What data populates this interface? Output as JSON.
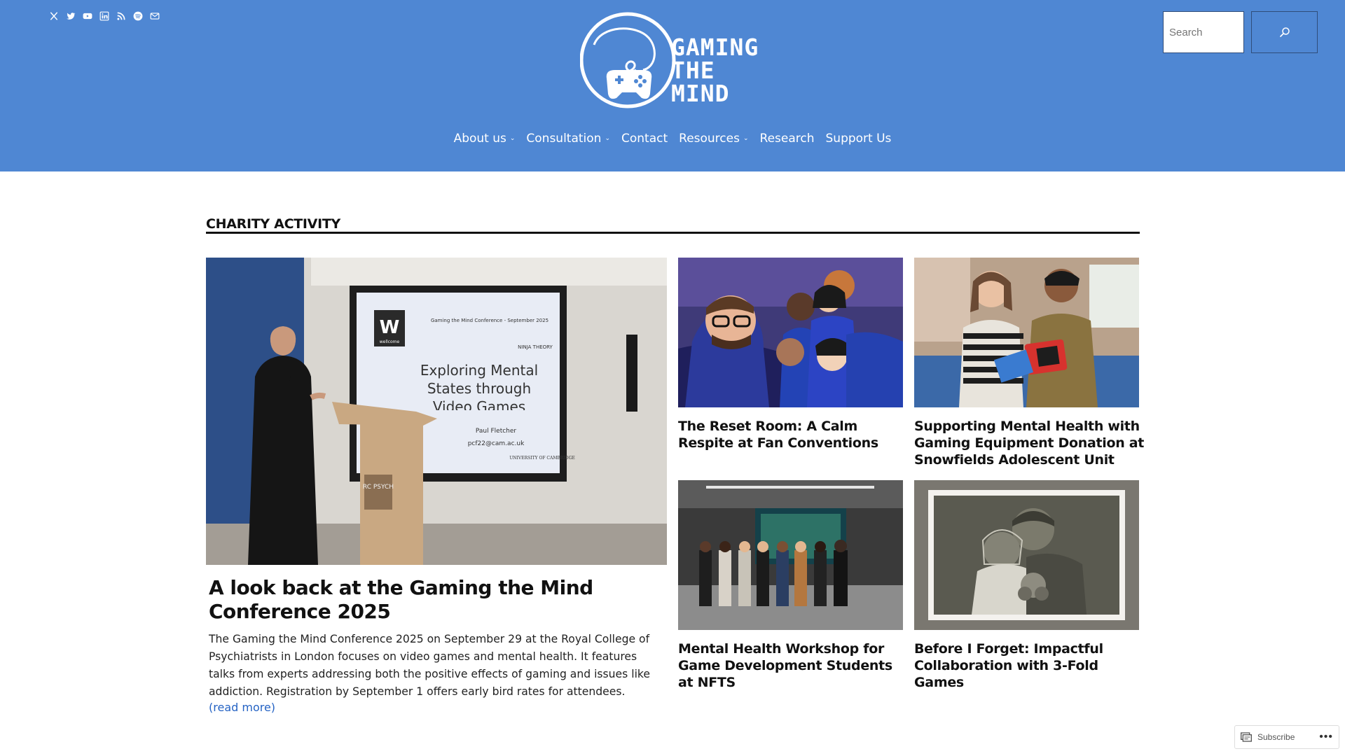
{
  "header": {
    "socials": [
      {
        "icon": "x-icon"
      },
      {
        "icon": "twitter-icon"
      },
      {
        "icon": "youtube-icon"
      },
      {
        "icon": "linkedin-icon"
      },
      {
        "icon": "rss-icon"
      },
      {
        "icon": "spotify-icon"
      },
      {
        "icon": "mail-icon"
      }
    ],
    "logo_text_lines": [
      "GAMING",
      "THE",
      "MIND"
    ],
    "search": {
      "placeholder": "Search",
      "value": ""
    },
    "nav": [
      {
        "label": "About us",
        "has_dropdown": true
      },
      {
        "label": "Consultation",
        "has_dropdown": true
      },
      {
        "label": "Contact",
        "has_dropdown": false
      },
      {
        "label": "Resources",
        "has_dropdown": true
      },
      {
        "label": "Research",
        "has_dropdown": false
      },
      {
        "label": "Support Us",
        "has_dropdown": false
      }
    ]
  },
  "main": {
    "section_title": "CHARITY ACTIVITY",
    "feature": {
      "title": "A look back at the Gaming the Mind Conference 2025",
      "excerpt": "The Gaming the Mind Conference 2025 on September 29 at the Royal College of Psychiatrists in London focuses on video games and mental health. It features talks from experts addressing both the positive effects of gaming and issues like addiction. Registration by September 1 offers early bird rates for attendees.",
      "read_more": "(read more)",
      "slide": {
        "logo": "W",
        "logo_sub": "wellcome",
        "header": "Gaming the Mind Conference - September 2025",
        "title": "Exploring Mental States through Video Games",
        "name": "Paul Fletcher",
        "email": "pcf22@cam.ac.uk",
        "partner": "NINJA THEORY",
        "uni": "UNIVERSITY OF CAMBRIDGE",
        "podium": "RC PSYCH"
      }
    },
    "cards": [
      {
        "title": "The Reset Room: A Calm Respite at Fan Conventions"
      },
      {
        "title": "Supporting Mental Health with Gaming Equipment Donation at Snowfields Adolescent Unit"
      },
      {
        "title": "Mental Health Workshop for Game Development Students at NFTS"
      },
      {
        "title": "Before I Forget: Impactful Collaboration with 3-Fold Games"
      }
    ]
  },
  "footer_widget": {
    "subscribe_label": "Subscribe",
    "more": "•••"
  },
  "colors": {
    "header_bg": "#4f87d3",
    "link": "#2563c4"
  }
}
